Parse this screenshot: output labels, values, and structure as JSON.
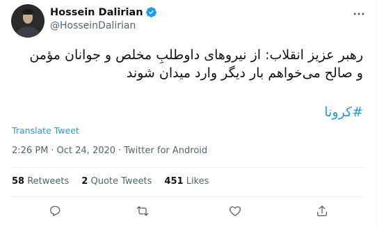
{
  "tweet": {
    "author": {
      "display_name": "Hossein Dalirian",
      "handle": "@HosseinDalirian",
      "verified": true
    },
    "text_line1": "رهبر عزیز انقلاب: از نیروهای داوطلبِ مخلص و جوانان مؤمن",
    "text_line2": "و صالح می‌خواهم بار دیگر وارد میدان شوند",
    "hashtag": "#کرونا",
    "translate_label": "Translate Tweet",
    "time": "2:26 PM",
    "date": "Oct 24, 2020",
    "source": "Twitter for Android",
    "stats": {
      "retweets_count": "58",
      "retweets_label": "Retweets",
      "quotes_count": "2",
      "quotes_label": "Quote Tweets",
      "likes_count": "451",
      "likes_label": "Likes"
    }
  },
  "icons": {
    "verified": "verified-badge-icon",
    "more": "more-options-icon",
    "reply": "reply-icon",
    "retweet": "retweet-icon",
    "like": "heart-icon",
    "share": "share-icon"
  },
  "colors": {
    "accent": "#1d9bf0",
    "text": "#0f1419",
    "secondary": "#536471",
    "divider": "#eff3f4"
  }
}
